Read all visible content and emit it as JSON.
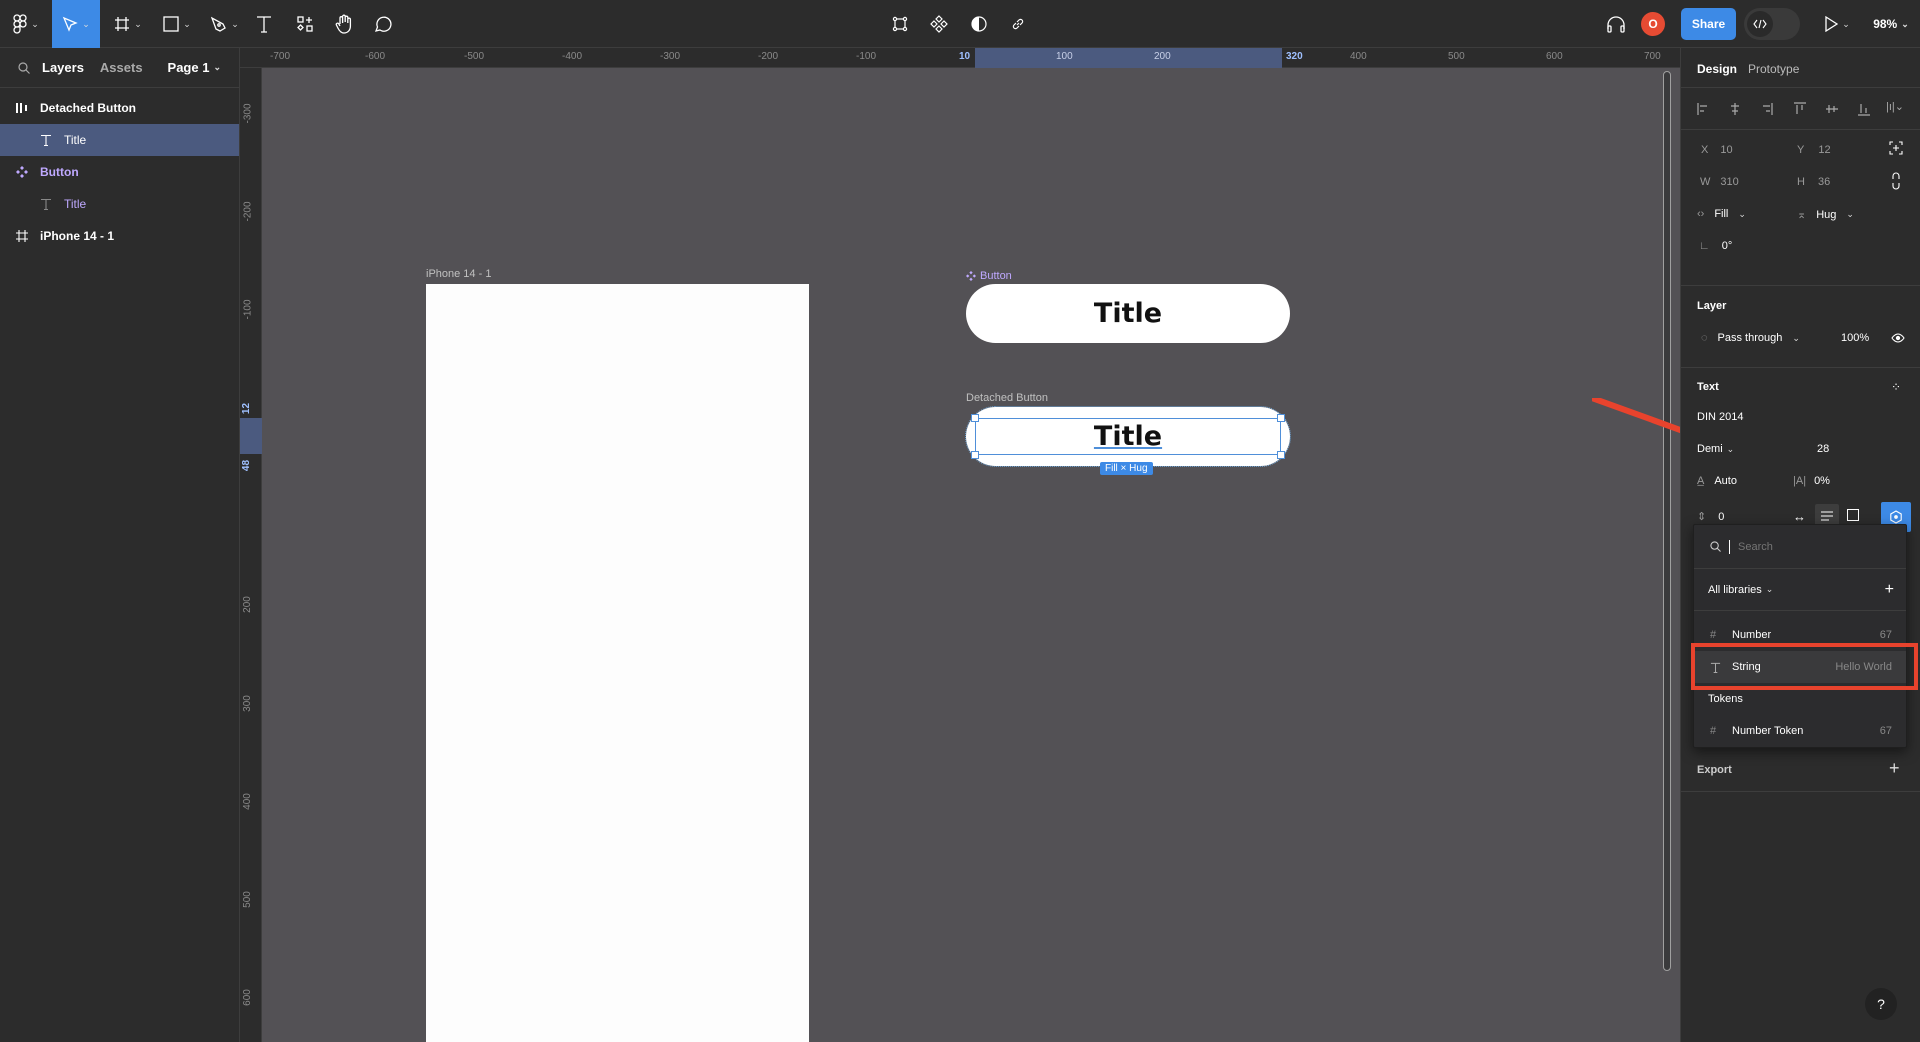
{
  "toolbar": {
    "main_menu_icon": "figma-logo-icon",
    "tools": [
      {
        "name": "move-tool",
        "icon": "cursor-arrow-icon",
        "active": true
      },
      {
        "name": "frame-tool",
        "icon": "frame-hash-icon"
      },
      {
        "name": "shape-tool",
        "icon": "rectangle-icon"
      },
      {
        "name": "pen-tool",
        "icon": "pen-icon"
      },
      {
        "name": "text-tool",
        "icon": "text-icon"
      },
      {
        "name": "resources-tool",
        "icon": "resources-icon"
      },
      {
        "name": "hand-tool",
        "icon": "hand-icon"
      },
      {
        "name": "comment-tool",
        "icon": "comment-icon"
      }
    ],
    "center_tools": [
      "edit-object-icon",
      "component-icon",
      "mask-contrast-icon",
      "link-icon"
    ],
    "avatar_initial": "O",
    "share_label": "Share",
    "dev_mode_icon": "code-icon",
    "zoom_level": "98%"
  },
  "left_panel": {
    "tabs": {
      "layers": "Layers",
      "assets": "Assets"
    },
    "page": "Page 1",
    "layers": [
      {
        "name": "Detached Button",
        "icon": "autolayout-icon",
        "indent": 0,
        "selected": false,
        "type": "frame"
      },
      {
        "name": "Title",
        "icon": "text-icon",
        "indent": 1,
        "selected": true,
        "type": "text"
      },
      {
        "name": "Button",
        "icon": "component-icon",
        "indent": 0,
        "selected": false,
        "type": "component"
      },
      {
        "name": "Title",
        "icon": "text-icon",
        "indent": 1,
        "selected": false,
        "type": "text"
      },
      {
        "name": "iPhone 14 - 1",
        "icon": "frame-hash-icon",
        "indent": 0,
        "selected": false,
        "type": "frame"
      }
    ]
  },
  "rulers": {
    "top": [
      "-700",
      "-600",
      "-500",
      "-400",
      "-300",
      "-200",
      "-100",
      "10",
      "100",
      "200",
      "320",
      "400",
      "500",
      "600",
      "700"
    ],
    "left": [
      "-300",
      "-200",
      "-100",
      "12",
      "48",
      "200",
      "300",
      "400",
      "500",
      "600"
    ]
  },
  "canvas": {
    "phone_frame_label": "iPhone 14 - 1",
    "button_label": "Button",
    "button_text": "Title",
    "detached_label": "Detached Button",
    "detached_text": "Title",
    "size_badge": "Fill × Hug"
  },
  "right_panel": {
    "tabs": {
      "design": "Design",
      "prototype": "Prototype"
    },
    "x": "10",
    "y": "12",
    "w": "310",
    "h": "36",
    "x_label": "X",
    "y_label": "Y",
    "w_label": "W",
    "h_label": "H",
    "width_mode": "Fill",
    "height_mode": "Hug",
    "rotation": "0°",
    "layer_title": "Layer",
    "blend_mode": "Pass through",
    "opacity": "100%",
    "text_title": "Text",
    "font_family": "DIN 2014",
    "font_weight": "Demi",
    "font_size": "28",
    "line_height": "Auto",
    "letter_spacing": "0%",
    "paragraph_spacing": "0",
    "export_title": "Export"
  },
  "variable_picker": {
    "search_placeholder": "Search",
    "library_filter": "All libraries",
    "items": [
      {
        "icon": "number-hash-icon",
        "name": "Number",
        "value": "67",
        "highlighted": false
      },
      {
        "icon": "text-icon",
        "name": "String",
        "value": "Hello World",
        "highlighted": true
      }
    ],
    "group_title": "Tokens",
    "group_items": [
      {
        "icon": "number-hash-icon",
        "name": "Number Token",
        "value": "67"
      }
    ]
  },
  "annotation": {
    "arrow_color": "#e8432d",
    "highlight_color": "#e8432d"
  },
  "help_label": "?"
}
